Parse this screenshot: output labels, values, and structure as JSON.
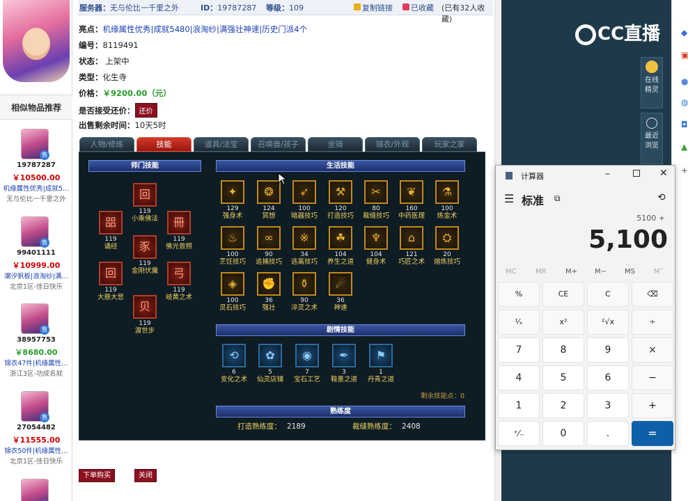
{
  "topbar": {
    "server_label": "服务器：",
    "server_value": "无与伦比一千里之外",
    "id_label": "ID：",
    "id_value": "19787287",
    "level_label": "等级：",
    "level_value": "109",
    "copy_link": "复制链接",
    "collected": "已收藏",
    "collect_count": "(已有32人收藏)"
  },
  "details": {
    "highlight_label": "亮点：",
    "highlight_value": "机缘属性优秀|成就5480|浪淘纱|满强壮神速|历史门派4个",
    "number_label": "编号：",
    "number_value": "8119491",
    "status_label": "状态：",
    "status_value": "上架中",
    "type_label": "类型：",
    "type_value": "化生寺",
    "price_label": "价格：",
    "price_value": "￥9200.00（元）",
    "bargain_label": "是否接受还价：",
    "bargain_btn": "还价",
    "remain_label": "出售剩余时间：",
    "remain_value": "10天5时"
  },
  "tabs": [
    "人物/修炼",
    "技能",
    "道具/法宝",
    "召唤兽/孩子",
    "坐骑",
    "锦衣/外观",
    "玩家之家"
  ],
  "headers": {
    "school": "师门技能",
    "life": "生活技能",
    "plot": "剧情技能",
    "proficiency": "熟练度"
  },
  "school_skills": [
    {
      "level": "119",
      "name": "小乘佛法"
    },
    {
      "level": "119",
      "name": "诵经"
    },
    {
      "level": "119",
      "name": "佛光普照"
    },
    {
      "level": "119",
      "name": "金刚伏魔"
    },
    {
      "level": "119",
      "name": "大慈大悲"
    },
    {
      "level": "119",
      "name": "岐黄之术"
    },
    {
      "level": "119",
      "name": "渡世步"
    }
  ],
  "life_skills": [
    {
      "level": "129",
      "name": "强身术"
    },
    {
      "level": "124",
      "name": "冥想"
    },
    {
      "level": "100",
      "name": "暗器技巧"
    },
    {
      "level": "120",
      "name": "打造技巧"
    },
    {
      "level": "80",
      "name": "裁缝技巧"
    },
    {
      "level": "160",
      "name": "中药医理"
    },
    {
      "level": "100",
      "name": "炼金术"
    },
    {
      "level": "100",
      "name": "烹饪技巧"
    },
    {
      "level": "90",
      "name": "追捕技巧"
    },
    {
      "level": "34",
      "name": "逃离技巧"
    },
    {
      "level": "104",
      "name": "养生之道"
    },
    {
      "level": "104",
      "name": "健身术"
    },
    {
      "level": "121",
      "name": "巧匠之术"
    },
    {
      "level": "20",
      "name": "熔炼技巧"
    },
    {
      "level": "100",
      "name": "灵石技巧"
    },
    {
      "level": "36",
      "name": "强壮"
    },
    {
      "level": "90",
      "name": "淬灵之术"
    },
    {
      "level": "36",
      "name": "神速"
    }
  ],
  "plot_skills": [
    {
      "level": "6",
      "name": "变化之术"
    },
    {
      "level": "5",
      "name": "仙灵店铺"
    },
    {
      "level": "7",
      "name": "宝石工艺"
    },
    {
      "level": "3",
      "name": "鞍墨之道"
    },
    {
      "level": "1",
      "name": "丹青之道"
    }
  ],
  "remain_points": "剩余技能点：0",
  "proficiency": {
    "forge_label": "打造熟练度：",
    "forge_value": "2189",
    "tailor_label": "裁缝熟练度：",
    "tailor_value": "2408"
  },
  "bottom_buttons": {
    "buy": "下单购买",
    "close": "关闭"
  },
  "similar": {
    "title": "相似物品推荐",
    "items": [
      {
        "id": "19787287",
        "price": "￥10500.00",
        "desc": "机缘属性优秀|成就5…",
        "server": "无与伦比一千里之外",
        "price_color": "red"
      },
      {
        "id": "99401111",
        "price": "￥10999.00",
        "desc": "潮汐帆板|浪淘纱|满…",
        "server": "北京1区-佳日快乐",
        "price_color": "red"
      },
      {
        "id": "38957753",
        "price": "￥8680.00",
        "desc": "锦衣47件|机缘属性…",
        "server": "浙江3区-功成名就",
        "price_color": "green"
      },
      {
        "id": "27054482",
        "price": "￥11555.00",
        "desc": "锦衣50件|机缘属性…",
        "server": "北京1区-佳日快乐",
        "price_color": "red"
      }
    ]
  },
  "stream": {
    "logo": "CC直播",
    "btn_online": "在线精灵",
    "btn_recent": "最近浏览"
  },
  "calculator": {
    "app_title": "计算器",
    "mode": "标准",
    "expression": "5100 +",
    "display": "5,100",
    "memory": [
      "MC",
      "MR",
      "M+",
      "M−",
      "MS",
      "M˅"
    ],
    "keys": [
      [
        "%",
        "CE",
        "C",
        "⌫"
      ],
      [
        "¹⁄ₓ",
        "x²",
        "²√x",
        "÷"
      ],
      [
        "7",
        "8",
        "9",
        "×"
      ],
      [
        "4",
        "5",
        "6",
        "−"
      ],
      [
        "1",
        "2",
        "3",
        "+"
      ],
      [
        "⁺⁄₋",
        "0",
        ".",
        "="
      ]
    ]
  }
}
